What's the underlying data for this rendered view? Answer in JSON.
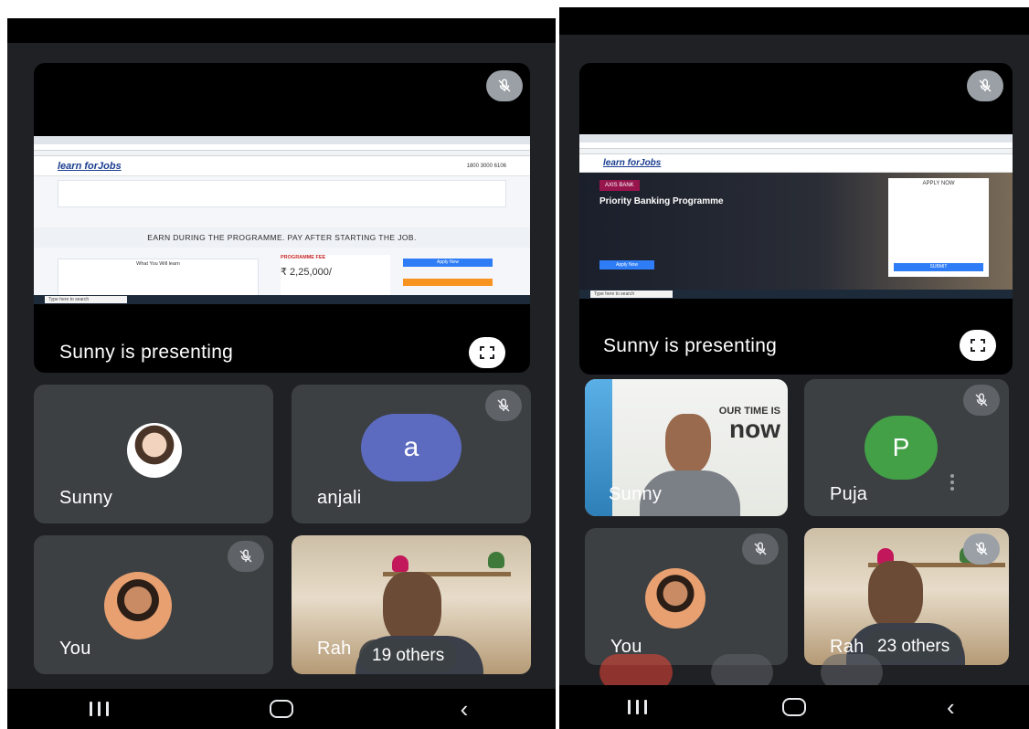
{
  "left": {
    "presenter_label": "Sunny is presenting",
    "shared_page": {
      "logo": "learn forJobs",
      "phone": "1800 3000 6106",
      "headline": "EARN DURING THE PROGRAMME. PAY AFTER STARTING THE JOB.",
      "learn_heading": "What You Will learn",
      "fee_label": "PROGRAMME FEE",
      "fee_value": "₹ 2,25,000/",
      "apply_button": "Apply Now",
      "taskbar_search": "Type here to search"
    },
    "tiles": [
      {
        "name": "Sunny",
        "avatar_type": "photo-child"
      },
      {
        "name": "anjali",
        "avatar_letter": "a",
        "avatar_color": "#5c6bc0"
      },
      {
        "name": "You",
        "avatar_type": "photo-woman"
      },
      {
        "name": "Rah",
        "others": "19 others"
      }
    ]
  },
  "right": {
    "presenter_label": "Sunny is presenting",
    "shared_page": {
      "logo": "learn forJobs",
      "bank": "AXIS BANK",
      "programme": "Priority Banking Programme",
      "form_title": "APPLY NOW",
      "submit": "SUBMIT",
      "apply_button": "Apply Now",
      "taskbar_search": "Type here to search"
    },
    "tiles": [
      {
        "name": "Sunny",
        "background_text_1": "OUR TIME IS",
        "background_text_2": "now"
      },
      {
        "name": "Puja",
        "avatar_letter": "P",
        "avatar_color": "#43a047"
      },
      {
        "name": "You",
        "avatar_type": "photo-woman"
      },
      {
        "name": "Rah",
        "others": "23 others"
      }
    ]
  },
  "colors": {
    "background": "#202124",
    "tile": "#3c4043",
    "end_call": "#ea4335"
  }
}
